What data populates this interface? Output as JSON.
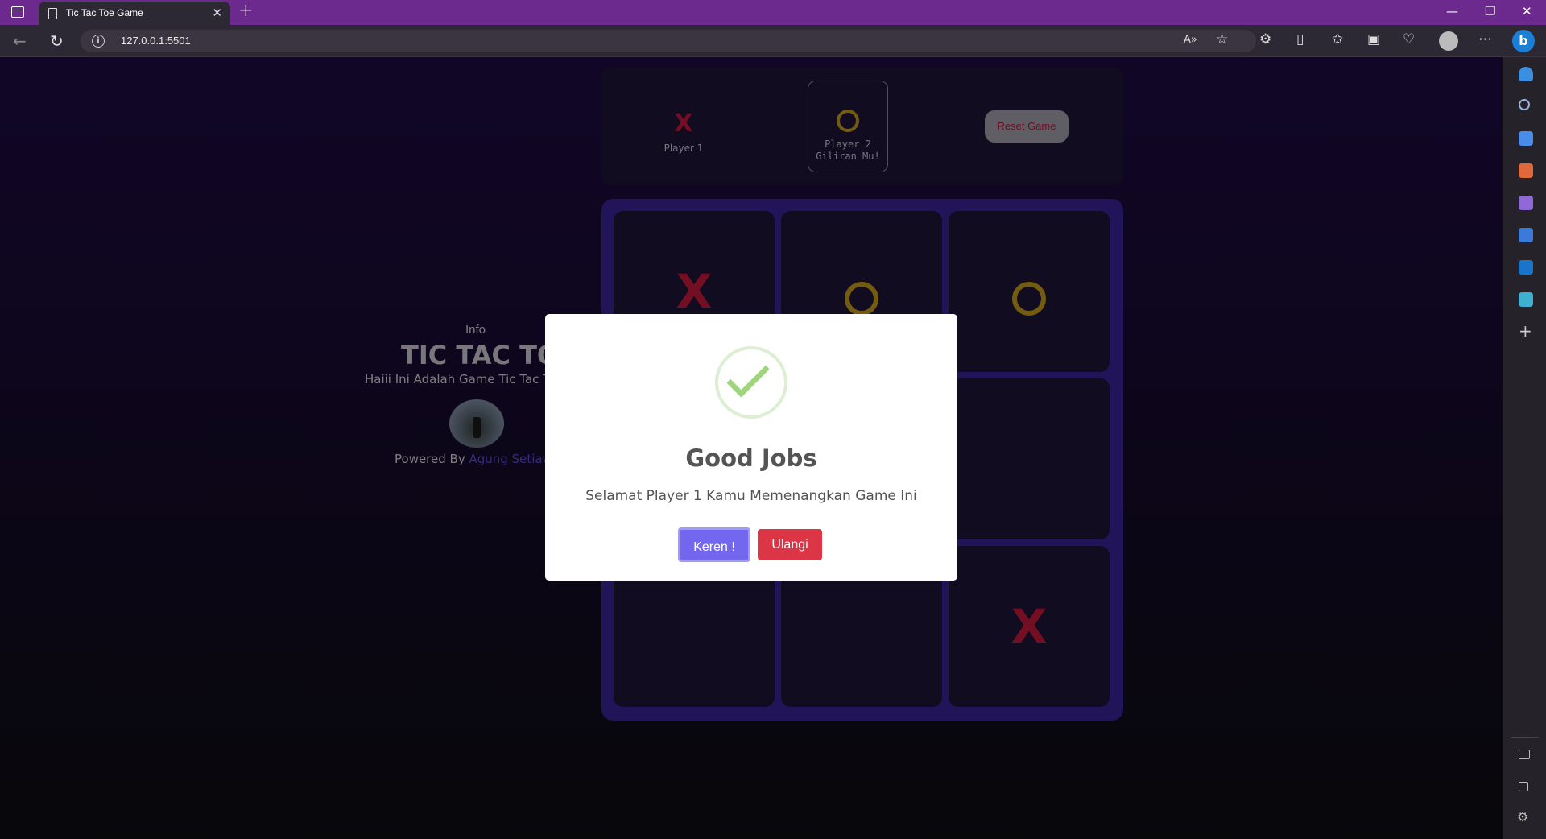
{
  "browser": {
    "tab_title": "Tic Tac Toe Game",
    "url": "127.0.0.1:5501"
  },
  "info": {
    "label": "Info",
    "title": "TIC TAC TOE",
    "description": "Haiii Ini Adalah Game Tic Tac Toe",
    "powered_prefix": "Powered By ",
    "author": "Agung Setiawan"
  },
  "score": {
    "player1_mark": "X",
    "player1_label": "Player 1",
    "player2_label": "Player 2",
    "player2_turn": "Giliran Mu!",
    "reset_label": "Reset Game"
  },
  "board": {
    "cells": [
      "X",
      "O",
      "O",
      "",
      "",
      "",
      "",
      "",
      "X"
    ]
  },
  "modal": {
    "title": "Good Jobs",
    "message": "Selamat Player 1 Kamu Memenangkan Game Ini",
    "confirm_label": "Keren !",
    "retry_label": "Ulangi"
  },
  "colors": {
    "x_color": "#c2183b",
    "o_color": "#c09a1c",
    "board_bg": "#3a2293",
    "tab_bar": "#6c2a8f",
    "confirm_button": "#7367f0",
    "retry_button": "#dc3545"
  }
}
